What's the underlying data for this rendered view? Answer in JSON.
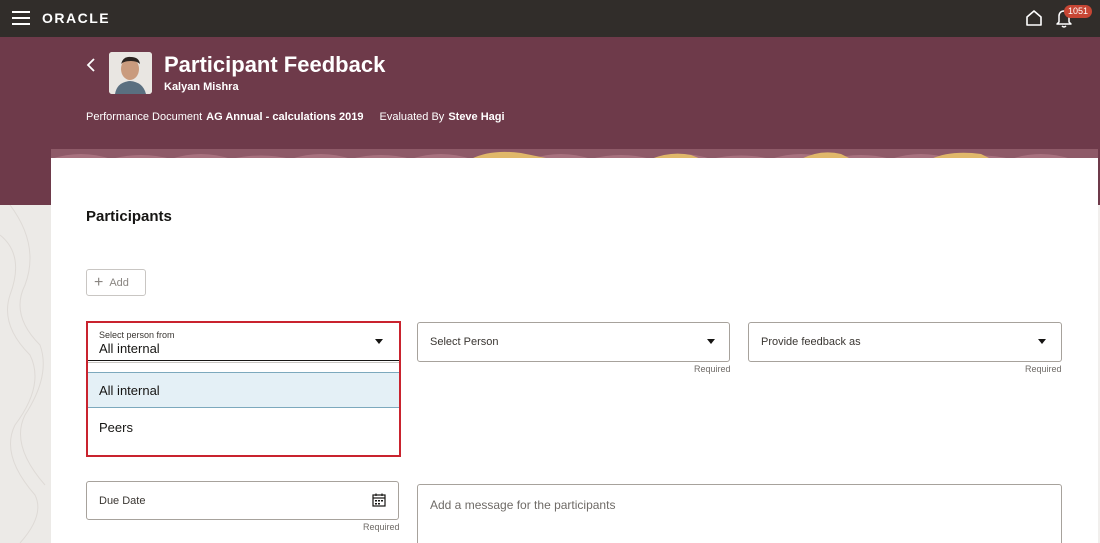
{
  "topbar": {
    "logo": "ORACLE",
    "notification_count": "1051"
  },
  "header": {
    "title": "Participant Feedback",
    "person_name": "Kalyan Mishra",
    "doc_label": "Performance Document",
    "doc_value": "AG Annual - calculations 2019",
    "eval_label": "Evaluated By",
    "eval_value": "Steve Hagi"
  },
  "participants": {
    "section_title": "Participants",
    "add_label": "Add",
    "select_from": {
      "label": "Select person from",
      "value": "All internal",
      "options": [
        "All internal",
        "Peers"
      ],
      "selected_index": 0
    },
    "select_person": {
      "placeholder": "Select Person",
      "required": "Required"
    },
    "feedback_as": {
      "placeholder": "Provide feedback as",
      "required": "Required"
    },
    "due_date": {
      "placeholder": "Due Date",
      "required": "Required"
    },
    "message": {
      "placeholder": "Add a message for the participants"
    }
  },
  "colors": {
    "topbar": "#312d2a",
    "header": "#6e3a4a",
    "highlight": "#c9232e",
    "badge": "#c74634",
    "selected_option": "#e4f0f6"
  }
}
